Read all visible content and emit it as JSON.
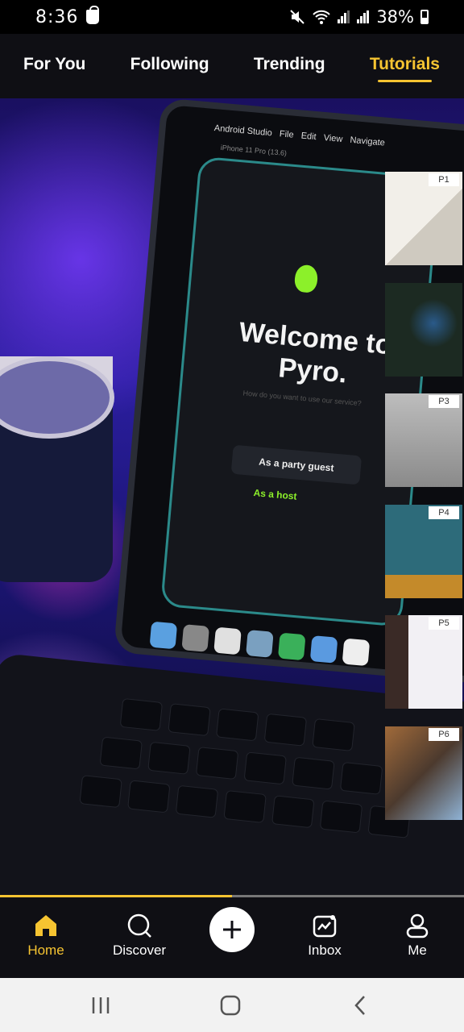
{
  "status_bar": {
    "time": "8:36",
    "battery": "38%"
  },
  "top_tabs": [
    {
      "label": "For You",
      "active": false
    },
    {
      "label": "Following",
      "active": false
    },
    {
      "label": "Trending",
      "active": false
    },
    {
      "label": "Tutorials",
      "active": true
    }
  ],
  "video": {
    "screen_title": "Welcome to Pyro.",
    "screen_subtitle": "How do you want to use our service?",
    "screen_button": "As a party guest",
    "screen_link": "As a host",
    "menu_bar": [
      "Android Studio",
      "File",
      "Edit",
      "View",
      "Navigate"
    ],
    "device_label": "iPhone 11 Pro (13.6)"
  },
  "playlist": [
    {
      "tag": "P1",
      "topic": "whiteboard-sticky-notes"
    },
    {
      "tag": "",
      "topic": "chalkboard-diagrams"
    },
    {
      "tag": "P3",
      "topic": "classroom-teacher"
    },
    {
      "tag": "P4",
      "topic": "teacher-at-chalkboard"
    },
    {
      "tag": "P5",
      "topic": "girl-writing-on-whiteboard"
    },
    {
      "tag": "P6",
      "topic": "students-in-classroom"
    }
  ],
  "progress": {
    "fraction": 0.5
  },
  "bottom_nav": [
    {
      "label": "Home",
      "icon": "home-icon",
      "active": true
    },
    {
      "label": "Discover",
      "icon": "search-icon",
      "active": false
    },
    {
      "label": "",
      "icon": "plus-icon",
      "active": false
    },
    {
      "label": "Inbox",
      "icon": "inbox-icon",
      "active": false
    },
    {
      "label": "Me",
      "icon": "profile-icon",
      "active": false
    }
  ],
  "colors": {
    "accent": "#f6c431",
    "bar_background": "#0f0f14",
    "system_nav": "#f2f2f2"
  }
}
